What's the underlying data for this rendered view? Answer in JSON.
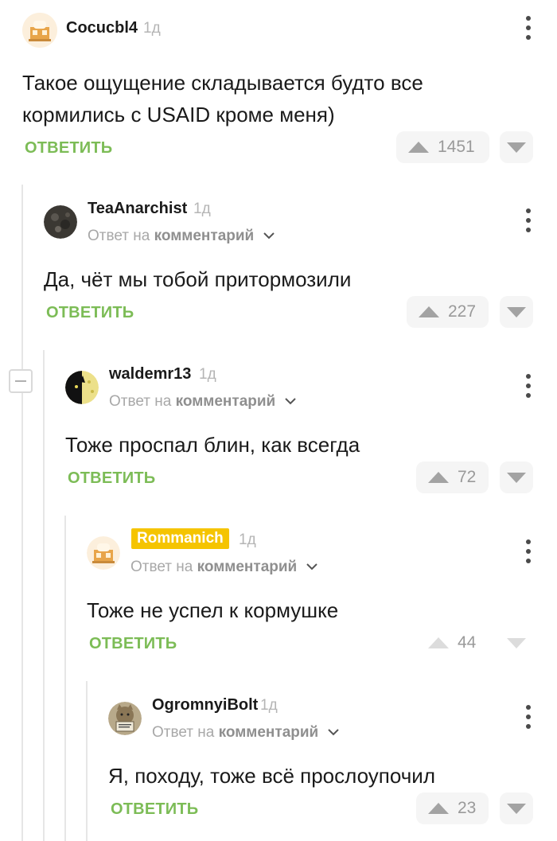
{
  "comments": [
    {
      "username": "Cocucbl4",
      "ago": "1д",
      "text": "Такое ощущение складывается будто все кормились с USAID кроме меня)",
      "reply_label": "ОТВЕТИТЬ",
      "votes": "1451",
      "avatar": "house-avatar"
    },
    {
      "username": "TeaAnarchist",
      "ago": "1д",
      "reply_prefix": "Ответ на",
      "reply_target": "комментарий",
      "text": "Да, чёт мы тобой притормозили",
      "reply_label": "ОТВЕТИТЬ",
      "votes": "227",
      "avatar": "dark-texture-avatar"
    },
    {
      "username": "waldemr13",
      "ago": "1д",
      "reply_prefix": "Ответ на",
      "reply_target": "комментарий",
      "text": "Тоже проспал блин, как всегда",
      "reply_label": "ОТВЕТИТЬ",
      "votes": "72",
      "avatar": "black-cat-avatar"
    },
    {
      "username": "Rommanich",
      "ago": "1д",
      "reply_prefix": "Ответ на",
      "reply_target": "комментарий",
      "text": "Тоже не успел к кормушке",
      "reply_label": "ОТВЕТИТЬ",
      "votes": "44",
      "avatar": "house-avatar",
      "badge_color": "#f5c400"
    },
    {
      "username": "OgromnyiBolt",
      "ago": "1д",
      "reply_prefix": "Ответ на",
      "reply_target": "комментарий",
      "text": "Я, походу, тоже всё прослоупочил",
      "reply_label": "ОТВЕТИТЬ",
      "votes": "23",
      "avatar": "cat-with-sign-avatar"
    }
  ],
  "colors": {
    "accent_green": "#7cbc56",
    "badge_yellow": "#f5c400",
    "muted_text": "#a8a8a8",
    "vote_bg": "#f5f5f5"
  },
  "icons": [
    "upvote-icon",
    "downvote-icon",
    "more-menu-icon",
    "chevron-down-icon",
    "collapse-thread-icon"
  ]
}
